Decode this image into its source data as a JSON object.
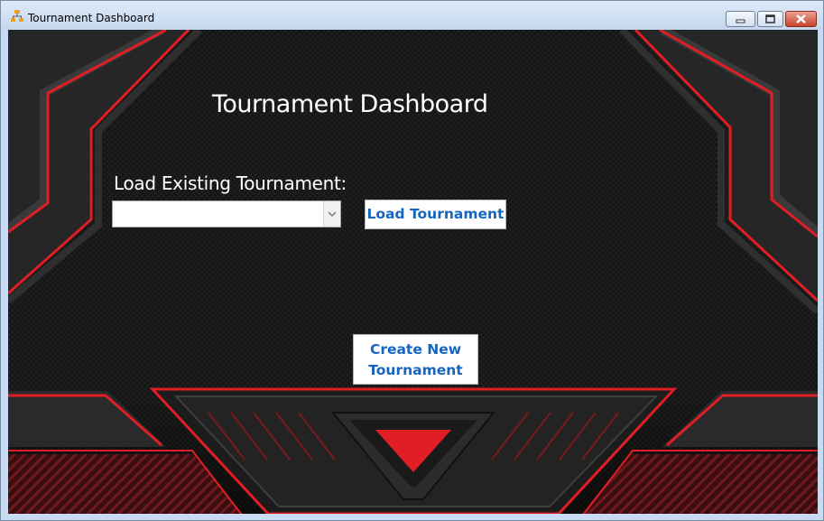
{
  "window": {
    "title": "Tournament Dashboard",
    "controls": [
      "minimize-icon",
      "maximize-icon",
      "close-icon"
    ],
    "accent_color": "#e11e24"
  },
  "main": {
    "heading": "Tournament Dashboard",
    "load_label": "Load Existing Tournament:",
    "tournament_select": {
      "selected": ""
    },
    "load_button": "Load Tournament",
    "create_button": "Create New\nTournament"
  }
}
